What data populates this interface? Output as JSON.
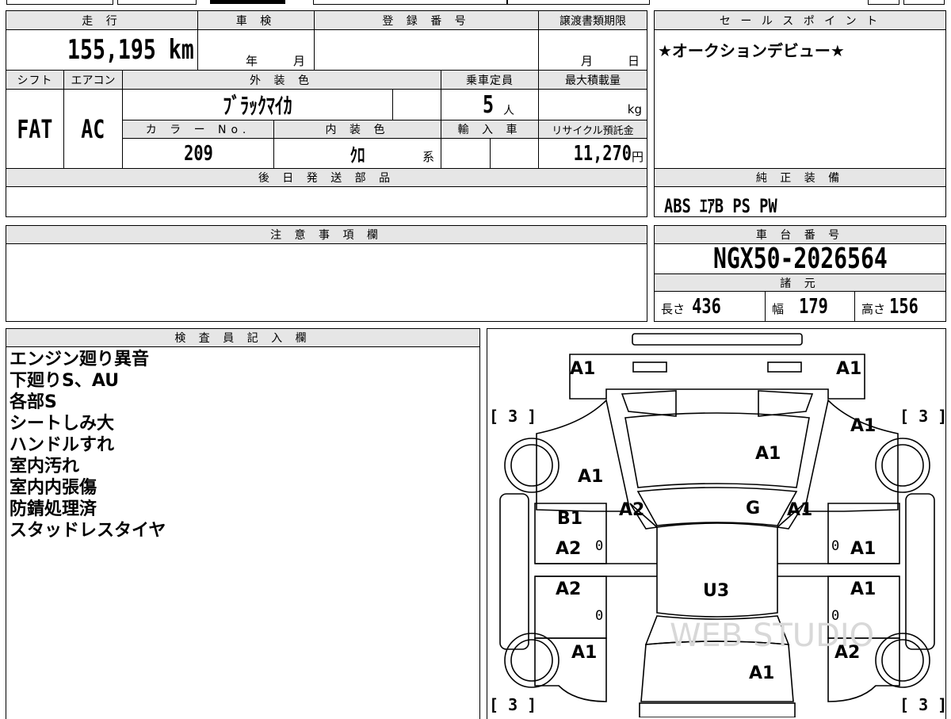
{
  "top_strip": {},
  "mileage": {
    "header": "走 行",
    "value": "155,195 km"
  },
  "inspection": {
    "header": "車 検",
    "year_unit": "年",
    "month_unit": "月"
  },
  "registration": {
    "header": "登 録 番 号",
    "value": ""
  },
  "transfer": {
    "header": "譲渡書類期限",
    "month_unit": "月",
    "day_unit": "日"
  },
  "shift": {
    "header": "シフト",
    "value": "FAT"
  },
  "aircon": {
    "header": "エアコン",
    "value": "AC"
  },
  "exterior_color": {
    "header": "外 装 色",
    "value": "ﾌﾞﾗｯｸﾏｲｶ"
  },
  "capacity": {
    "header": "乗車定員",
    "value": "5",
    "unit": "人"
  },
  "max_load": {
    "header": "最大積載量",
    "unit": "kg"
  },
  "color_no": {
    "header": "カ ラ ー No.",
    "value": "209"
  },
  "interior_color": {
    "header": "内 装 色",
    "value": "ｸﾛ",
    "suffix": "系"
  },
  "import": {
    "header": "輸 入 車"
  },
  "recycle": {
    "header": "リサイクル預託金",
    "value": "11,270",
    "unit": "円"
  },
  "later_parts": {
    "header": "後 日 発 送 部 品"
  },
  "sales_point": {
    "header": "セ ー ル ス ポ イ ン ト",
    "text": "★オークションデビュー★"
  },
  "genuine": {
    "header": "純 正 装 備",
    "text": "ABS ｴｱB PS PW"
  },
  "caution": {
    "header": "注 意 事 項 欄"
  },
  "chassis": {
    "header": "車 台 番 号",
    "value": "NGX50-2026564"
  },
  "specs": {
    "header": "諸 元",
    "length_label": "長さ",
    "length": "436",
    "width_label": "幅",
    "width": "179",
    "height_label": "高さ",
    "height": "156"
  },
  "inspector": {
    "header": "検 査 員 記 入 欄",
    "notes": [
      "エンジン廻り異音",
      "下廻りS、AU",
      "各部S",
      "シートしみ大",
      "ハンドルすれ",
      "室内汚れ",
      "室内内張傷",
      "防錆処理済",
      "スタッドレスタイヤ"
    ]
  },
  "diagram": {
    "watermark": "WEB STUDIO",
    "tire_marks": [
      "[ 3 ]",
      "[ 3 ]",
      "[ 3 ]",
      "[ 3 ]"
    ],
    "zero": "0",
    "labels": {
      "front_left": "A1",
      "front_right": "A1",
      "fender_right_top": "A1",
      "hood": "A1",
      "fender_left": "A1",
      "pillar_left": "A2",
      "windshield": "G",
      "pillar_right": "A1",
      "door_fl_1": "B1",
      "door_fl_2": "A2",
      "door_fr": "A1",
      "door_rl": "A2",
      "door_rr": "A1",
      "roof": "U3",
      "rear_left": "A1",
      "rear_right": "A2",
      "rear_center": "A1"
    }
  }
}
